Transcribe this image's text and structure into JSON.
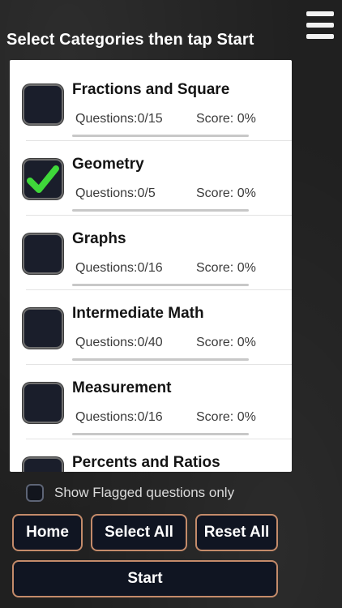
{
  "header": {
    "title": "Select Categories then tap Start",
    "menu_icon": "hamburger-menu-icon"
  },
  "categories": [
    {
      "name": "Fractions and Square",
      "questions": "Questions:0/15",
      "score": "Score: 0%",
      "checked": false
    },
    {
      "name": "Geometry",
      "questions": "Questions:0/5",
      "score": "Score: 0%",
      "checked": true
    },
    {
      "name": "Graphs",
      "questions": "Questions:0/16",
      "score": "Score: 0%",
      "checked": false
    },
    {
      "name": "Intermediate Math",
      "questions": "Questions:0/40",
      "score": "Score: 0%",
      "checked": false
    },
    {
      "name": "Measurement",
      "questions": "Questions:0/16",
      "score": "Score: 0%",
      "checked": false
    },
    {
      "name": "Percents and Ratios",
      "questions": "",
      "score": "",
      "checked": false
    }
  ],
  "flagged": {
    "label": "Show Flagged questions only",
    "checked": false
  },
  "buttons": {
    "home": "Home",
    "select_all": "Select All",
    "reset_all": "Reset All",
    "start": "Start"
  },
  "colors": {
    "check": "#3fd83a",
    "button_border": "#c48b6a",
    "button_bg": "#101522"
  }
}
